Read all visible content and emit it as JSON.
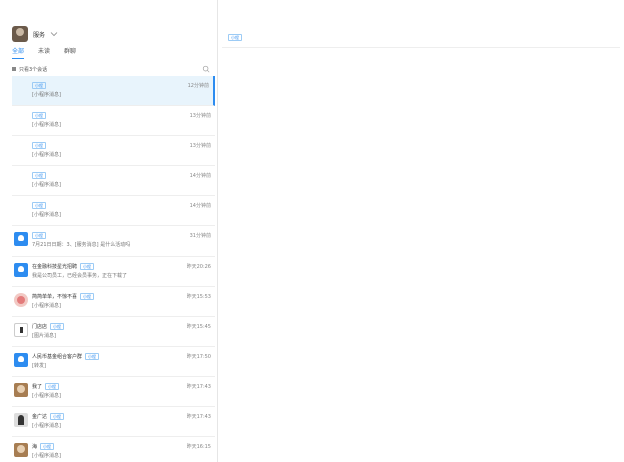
{
  "header": {
    "user_name": "服务",
    "tabs": [
      "全部",
      "未读",
      "群聊"
    ],
    "active_tab": 0
  },
  "filter": {
    "label": "只看3个会话"
  },
  "conversations": [
    {
      "tag": "小程",
      "preview": "[小程序消息]",
      "time": "12分钟前",
      "avatar": "none",
      "selected": true
    },
    {
      "tag": "小程",
      "preview": "[小程序消息]",
      "time": "13分钟前",
      "avatar": "none"
    },
    {
      "tag": "小程",
      "preview": "[小程序消息]",
      "time": "13分钟前",
      "avatar": "none"
    },
    {
      "tag": "小程",
      "preview": "[小程序消息]",
      "time": "14分钟前",
      "avatar": "none"
    },
    {
      "tag": "小程",
      "preview": "[小程序消息]",
      "time": "14分钟前",
      "avatar": "none"
    },
    {
      "tag": "小程",
      "preview": "7月21日日期：3、[服务消息] 是什么活动吗",
      "time": "31分钟前",
      "avatar": "blue"
    },
    {
      "title": "在金融科技星光招聘",
      "tag": "小程",
      "preview": "我是公司员工，已经会员事务，正在下载了",
      "time": "昨天20:26",
      "avatar": "blue"
    },
    {
      "title": "简简单单，不惊不喜",
      "tag": "小程",
      "preview": "[小程序消息]",
      "time": "昨天15:53",
      "avatar": "pink"
    },
    {
      "title": "门店店",
      "tag": "小程",
      "preview": "[图片消息]",
      "time": "昨天15:45",
      "avatar": "gray"
    },
    {
      "title": "人民币基金组合客户群",
      "tag": "小程",
      "preview": "[转发]",
      "time": "昨天17:50",
      "avatar": "blue"
    },
    {
      "title": "我了",
      "tag": "小程",
      "preview": "[小程序消息]",
      "time": "昨天17:43",
      "avatar": "photo"
    },
    {
      "title": "金广达",
      "tag": "小程",
      "preview": "[小程序消息]",
      "time": "昨天17:43",
      "avatar": "dark"
    },
    {
      "title": "海",
      "tag": "小程",
      "preview": "[小程序消息]",
      "time": "昨天16:15",
      "avatar": "photo"
    }
  ],
  "main": {
    "badge": "小程"
  },
  "colors": {
    "accent": "#2d8cf0",
    "selected_bg": "#e8f4fc"
  }
}
